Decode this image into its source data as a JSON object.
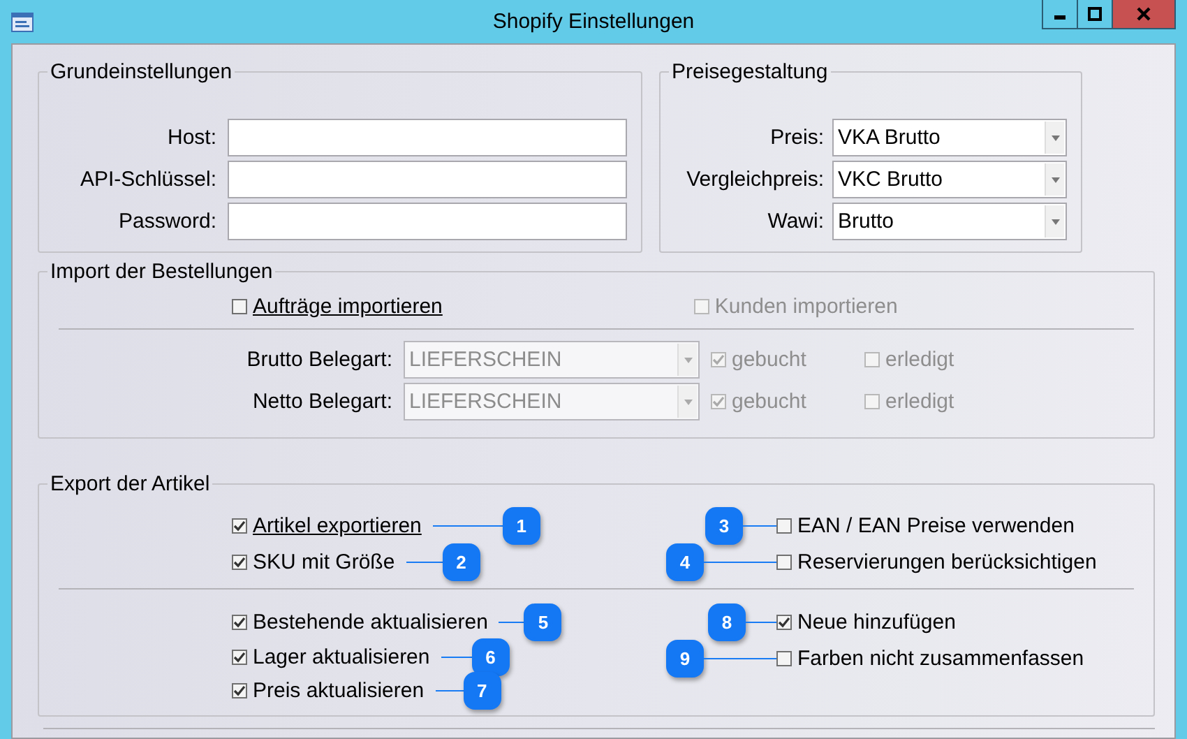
{
  "window": {
    "title": "Shopify Einstellungen"
  },
  "basic": {
    "title": "Grundeinstellungen",
    "fields": [
      {
        "label": "Host:"
      },
      {
        "label": "API-Schlüssel:"
      },
      {
        "label": "Password:"
      }
    ]
  },
  "pricing": {
    "title": "Preisegestaltung",
    "selects": [
      {
        "label": "Preis:",
        "value": "VKA Brutto"
      },
      {
        "label": "Vergleichpreis:",
        "value": "VKC Brutto"
      },
      {
        "label": "Wawi:",
        "value": "Brutto"
      }
    ]
  },
  "import": {
    "title": "Import der Bestellungen",
    "options": [
      {
        "label": "Aufträge importieren",
        "checked": false,
        "disabled": false,
        "underlined": true
      },
      {
        "label": "Kunden importieren",
        "checked": false,
        "disabled": true,
        "underlined": false
      }
    ],
    "rows": [
      {
        "label": "Brutto Belegart:",
        "value": "LIEFERSCHEIN",
        "disabled": true,
        "booked": {
          "label": "gebucht",
          "checked": true,
          "disabled": true
        },
        "done": {
          "label": "erledigt",
          "checked": false,
          "disabled": true
        }
      },
      {
        "label": "Netto Belegart:",
        "value": "LIEFERSCHEIN",
        "disabled": true,
        "booked": {
          "label": "gebucht",
          "checked": true,
          "disabled": true
        },
        "done": {
          "label": "erledigt",
          "checked": false,
          "disabled": true
        }
      }
    ]
  },
  "export": {
    "title": "Export der Artikel",
    "groups": [
      {
        "left": [
          {
            "label": "Artikel exportieren",
            "checked": true,
            "underlined": true,
            "callout": "1"
          },
          {
            "label": "SKU mit Größe",
            "checked": true,
            "underlined": false,
            "callout": "2"
          }
        ],
        "right": [
          {
            "label": "EAN / EAN Preise verwenden",
            "checked": false,
            "underlined": false,
            "callout": "3"
          },
          {
            "label": "Reservierungen berücksichtigen",
            "checked": false,
            "underlined": false,
            "callout": "4"
          }
        ]
      },
      {
        "left": [
          {
            "label": "Bestehende aktualisieren",
            "checked": true,
            "underlined": false,
            "callout": "5"
          },
          {
            "label": "Lager aktualisieren",
            "checked": true,
            "underlined": false,
            "callout": "6"
          },
          {
            "label": "Preis aktualisieren",
            "checked": true,
            "underlined": false,
            "callout": "7"
          }
        ],
        "right": [
          {
            "label": "Neue hinzufügen",
            "checked": true,
            "underlined": false,
            "callout": "8"
          },
          {
            "label": "Farben nicht zusammenfassen",
            "checked": false,
            "underlined": false,
            "callout": "9"
          }
        ]
      }
    ]
  }
}
